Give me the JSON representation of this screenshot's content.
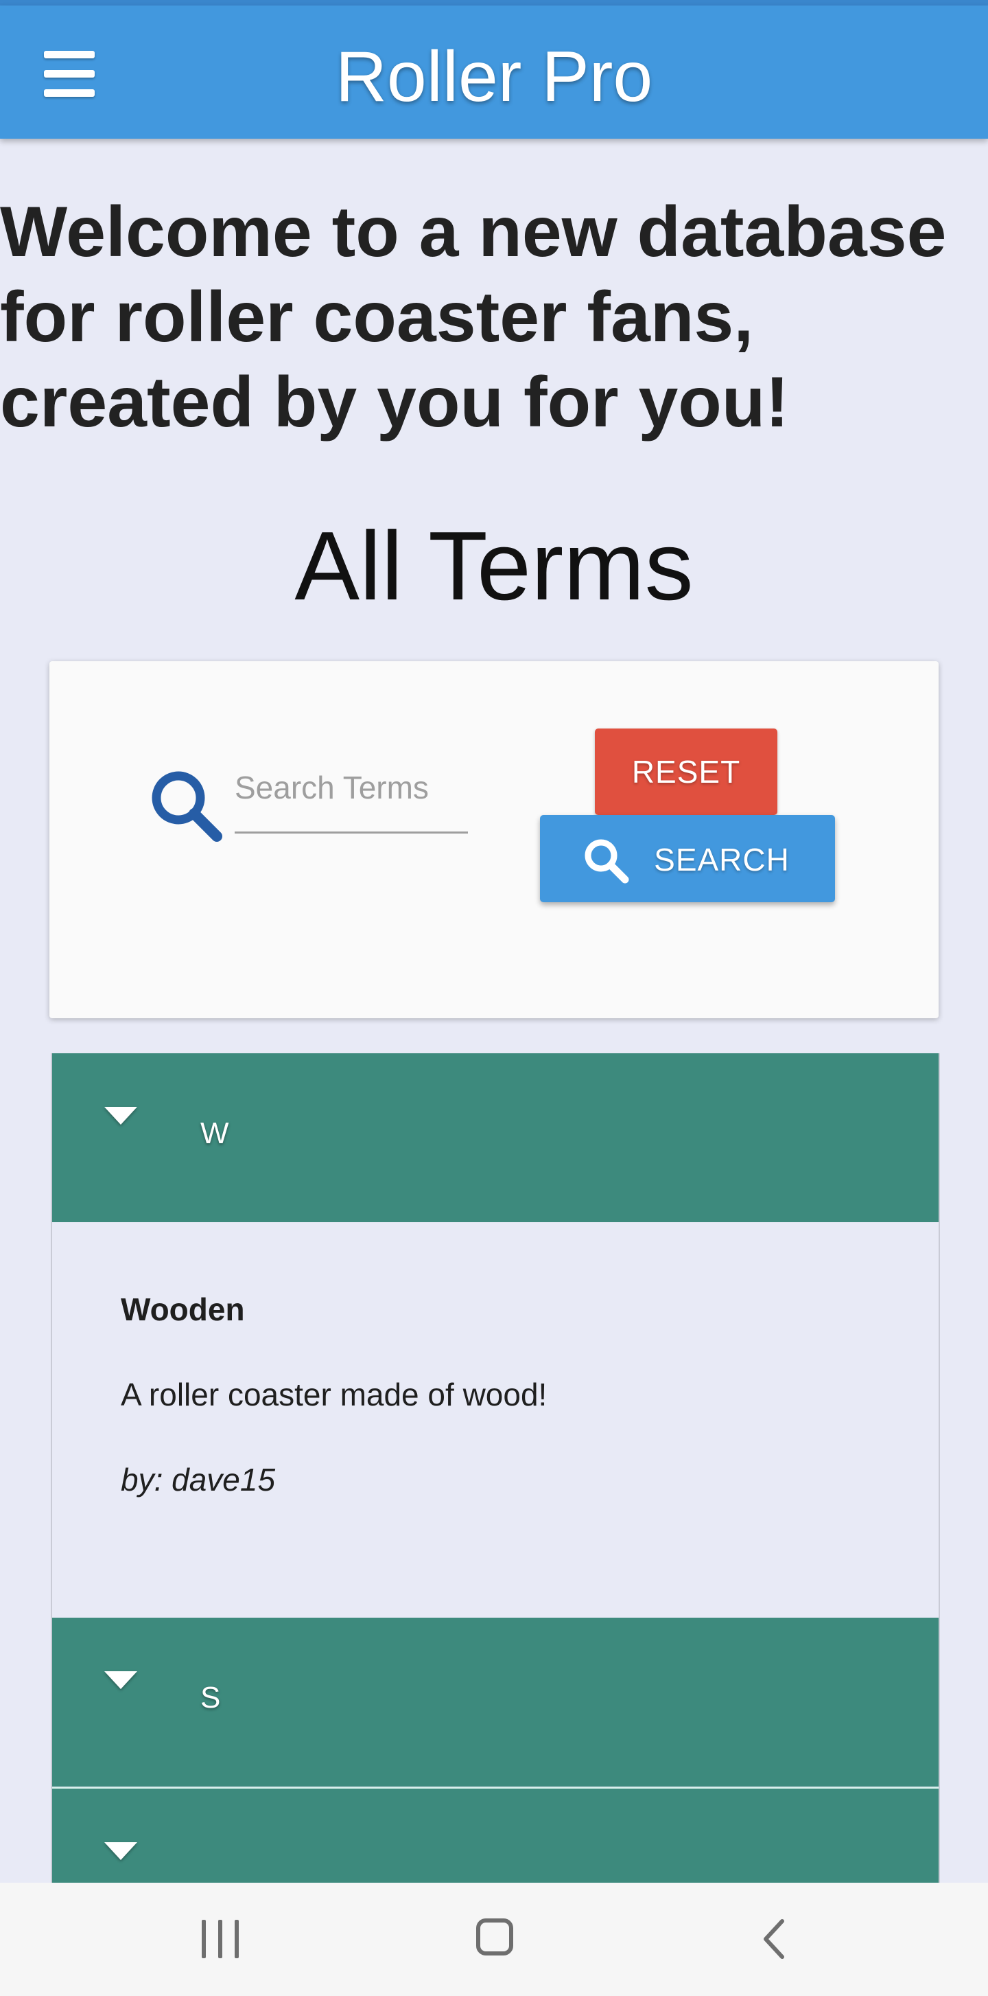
{
  "app_bar": {
    "title": "Roller Pro",
    "menu_icon": "hamburger-menu-icon"
  },
  "welcome_heading": "Welcome to a new database for roller coaster fans, created by you for you!",
  "section_title": "All Terms",
  "search": {
    "placeholder": "Search Terms",
    "value": "",
    "icon": "search-icon",
    "reset_label": "RESET",
    "search_label": "SEARCH"
  },
  "terms": {
    "groups": [
      {
        "letter": "W",
        "expanded": true,
        "entries": [
          {
            "name": "Wooden",
            "definition": "A roller coaster made of wood!",
            "author": "by: dave15"
          }
        ]
      },
      {
        "letter": "S",
        "expanded": false
      },
      {
        "letter": "",
        "expanded": false
      }
    ]
  },
  "nav_bar": {
    "recent_icon": "recent-apps-icon",
    "home_icon": "home-icon",
    "back_icon": "back-icon"
  },
  "colors": {
    "app_bar": "#4298de",
    "background": "#e8eaf6",
    "accordion_header": "#3d8a7d",
    "reset_button": "#e0503f",
    "search_button": "#4298de",
    "search_icon": "#265da6"
  }
}
